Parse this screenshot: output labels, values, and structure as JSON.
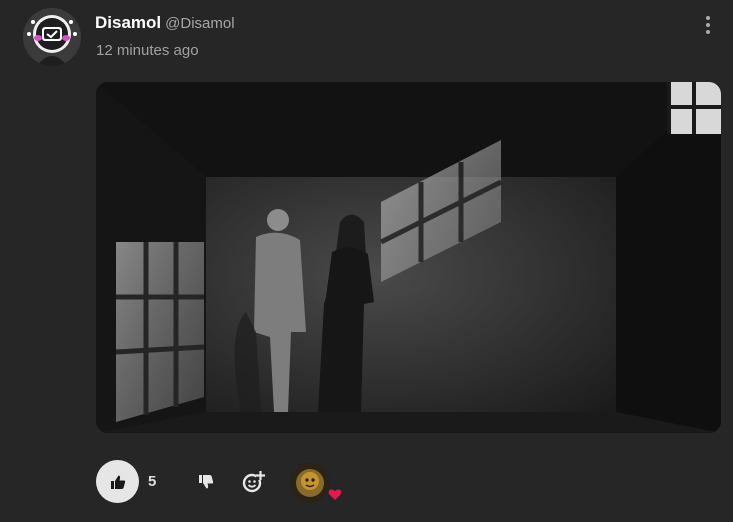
{
  "post": {
    "author_name": "Disamol",
    "author_handle": "@Disamol",
    "timestamp": "12 minutes ago"
  },
  "actions": {
    "like_count": "5"
  },
  "icons": {
    "more": "more-vertical-icon",
    "like": "thumbs-up-icon",
    "dislike": "thumbs-down-icon",
    "add_reaction": "add-reaction-icon",
    "heart": "heart-icon"
  },
  "colors": {
    "background": "#262626",
    "author_name": "#ffffff",
    "muted_text": "#a0a0a0",
    "like_button_bg": "#e6e6e6",
    "heart": "#e8174f"
  }
}
